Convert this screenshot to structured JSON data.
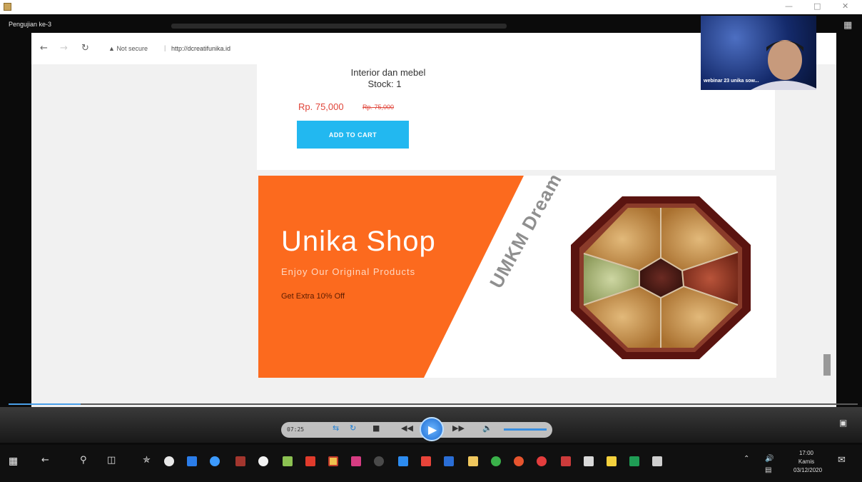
{
  "window": {
    "title": "Pengujian ke-3"
  },
  "browser": {
    "security_label": "Not secure",
    "url": "http://dcreatifunika.id"
  },
  "product": {
    "name": "Interior dan mebel",
    "stock": "Stock: 1",
    "price": "Rp. 75,000",
    "old_price": "Rp. 75,000",
    "add_to_cart": "ADD TO CART"
  },
  "banner": {
    "title": "Unika Shop",
    "subtitle": "Enjoy Our Original Products",
    "offer": "Get Extra 10% Off",
    "watermark": "UMKM Dream",
    "accent_color": "#fc6a1e"
  },
  "webcam": {
    "label": "webinar 23 unika sow..."
  },
  "player": {
    "time": "07:25",
    "progress": 0.085
  },
  "taskbar": {
    "time": "17:00",
    "day": "Kamis",
    "date": "03/12/2020"
  },
  "icons": {
    "app": "app-icon",
    "back": "back-arrow-icon",
    "forward": "forward-arrow-icon",
    "reload": "reload-icon",
    "warning": "warning-icon",
    "play": "play-icon",
    "start": "windows-start-icon"
  }
}
